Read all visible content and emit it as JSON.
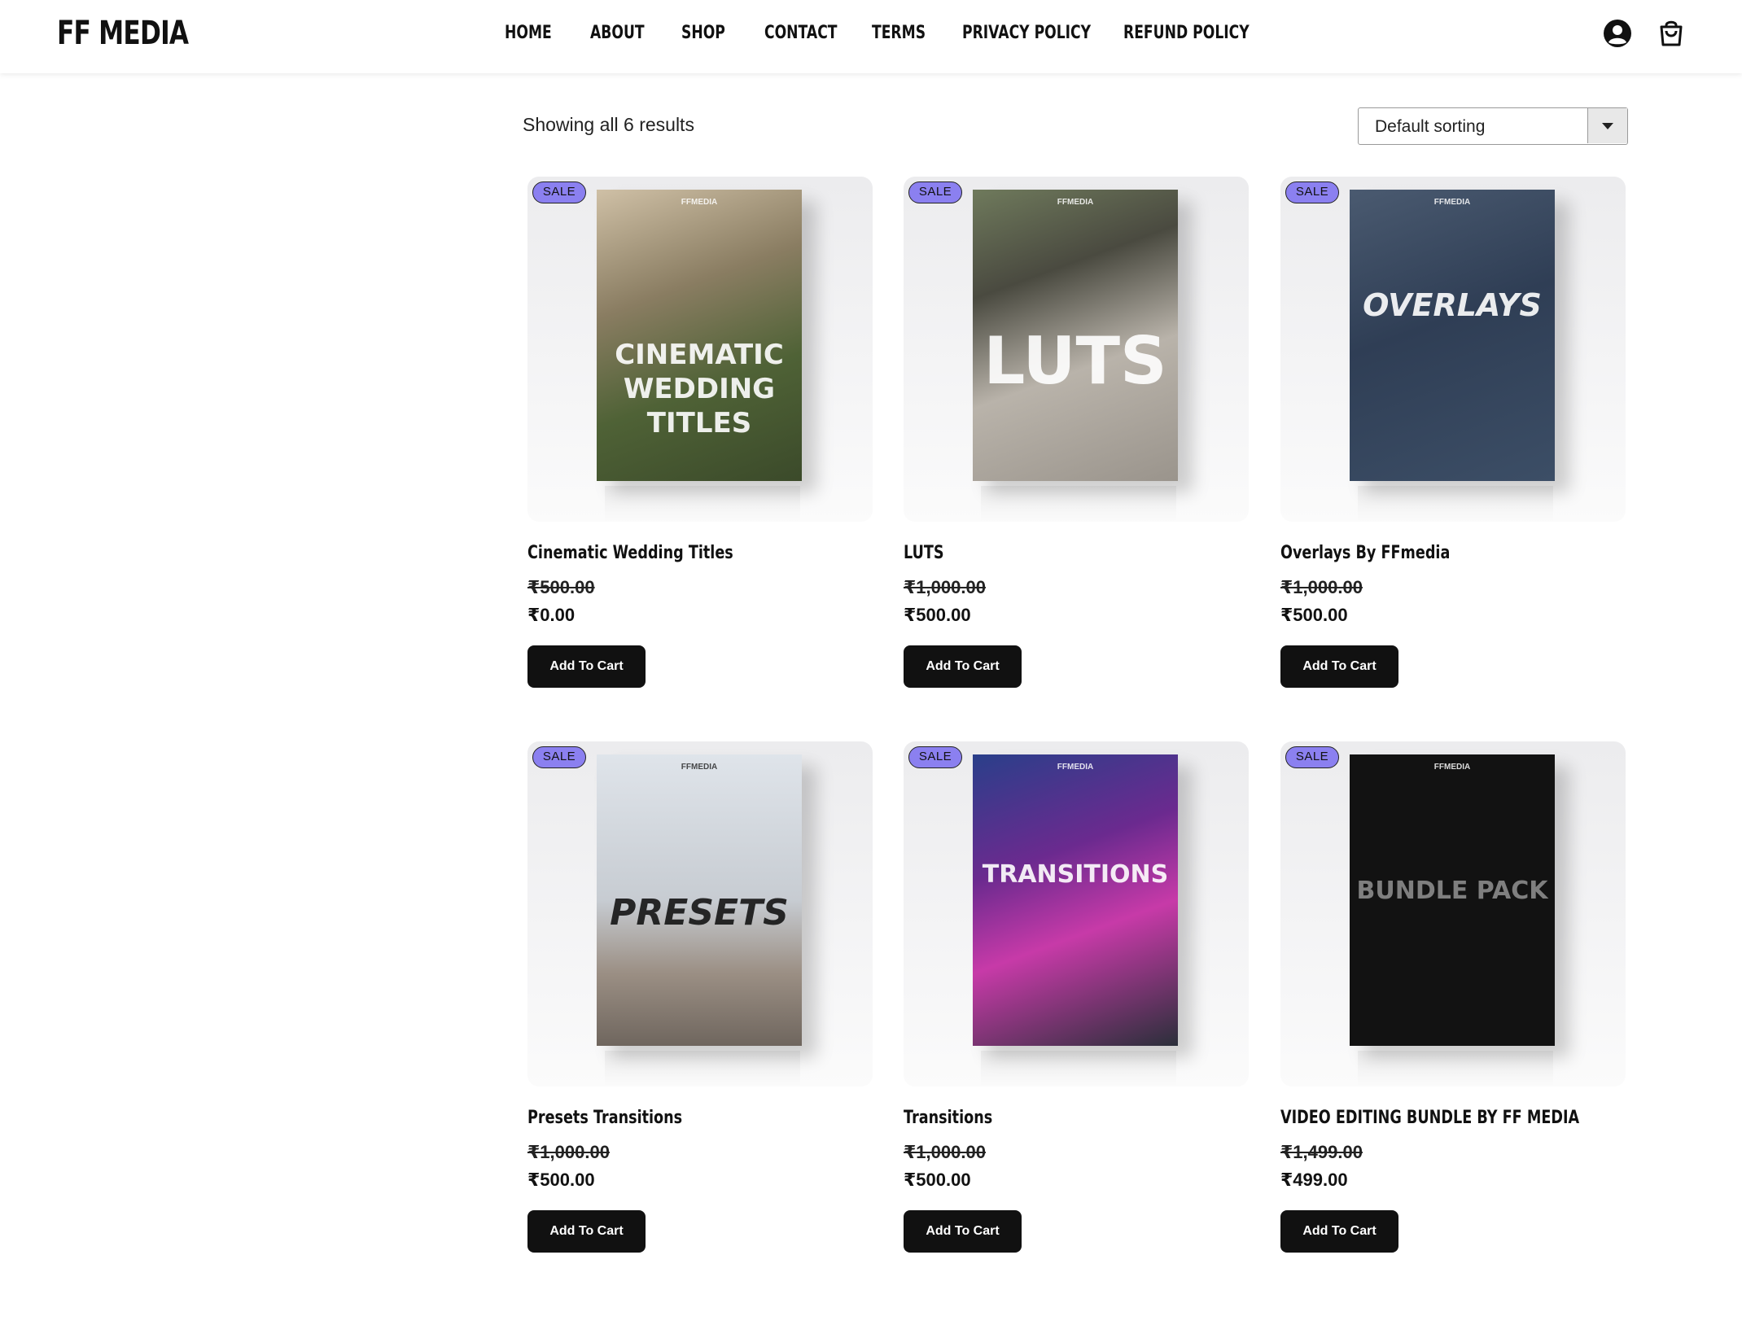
{
  "header": {
    "logo": "FF MEDIA",
    "nav": [
      "HOME",
      "ABOUT",
      "SHOP",
      "CONTACT",
      "TERMS",
      "PRIVACY POLICY",
      "REFUND POLICY"
    ],
    "icons": [
      "account-icon",
      "cart-icon"
    ]
  },
  "toolbar": {
    "result_count": "Showing all 6 results",
    "sort_selected": "Default sorting"
  },
  "badge": "SALE",
  "brand_text": "FFMEDIA",
  "products": [
    {
      "title": "Cinematic Wedding Titles",
      "old_price": "₹500.00",
      "price": "₹0.00",
      "button": "Add To Cart",
      "art_text": "CINEMATIC WEDDING TITLES"
    },
    {
      "title": "LUTS",
      "old_price": "₹1,000.00",
      "price": "₹500.00",
      "button": "Add To Cart",
      "art_text": "LUTS"
    },
    {
      "title": "Overlays By FFmedia",
      "old_price": "₹1,000.00",
      "price": "₹500.00",
      "button": "Add To Cart",
      "art_text": "OVERLAYS"
    },
    {
      "title": "Presets Transitions",
      "old_price": "₹1,000.00",
      "price": "₹500.00",
      "button": "Add To Cart",
      "art_text": "PRESETS"
    },
    {
      "title": "Transitions",
      "old_price": "₹1,000.00",
      "price": "₹500.00",
      "button": "Add To Cart",
      "art_text": "TRANSITIONS"
    },
    {
      "title": "VIDEO EDITING BUNDLE BY FF MEDIA",
      "old_price": "₹1,499.00",
      "price": "₹499.00",
      "button": "Add To Cart",
      "art_text": "BUNDLE PACK"
    }
  ]
}
